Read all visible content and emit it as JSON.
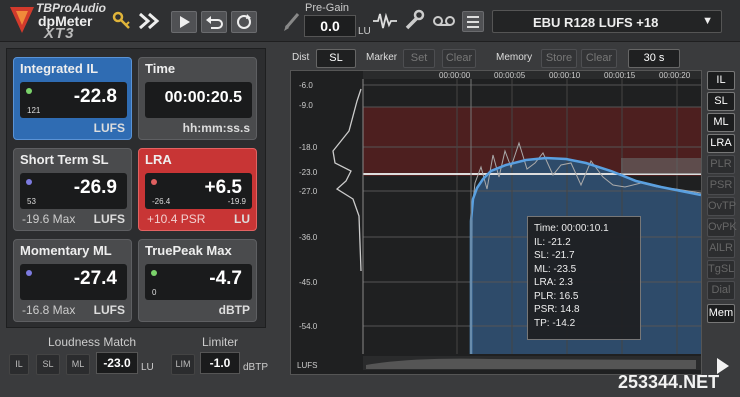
{
  "app": {
    "brand": "TBProAudio",
    "product": "dpMeter",
    "edition": "XT3"
  },
  "toolbar": {
    "pregain_label": "Pre-Gain",
    "pregain_value": "0.0",
    "pregain_unit": "LU",
    "preset": "EBU R128 LUFS +18"
  },
  "meters": [
    {
      "title": "Integrated IL",
      "value": "-22.8",
      "small": "121",
      "foot_left": "",
      "foot_right": "LUFS",
      "color": "#2f6cb3",
      "dot": "#7bd36b"
    },
    {
      "title": "Time",
      "value": "00:00:20.5",
      "foot_left": "",
      "foot_right": "hh:mm:ss.s"
    },
    {
      "title": "Short Term SL",
      "value": "-26.9",
      "small": "53",
      "foot_left": "-19.6 Max",
      "foot_right": "LUFS",
      "dot": "#7d7be0"
    },
    {
      "title": "LRA",
      "value": "+6.5",
      "small": "-26.4",
      "small2": "-19.9",
      "foot_left": "+10.4 PSR",
      "foot_right": "LU",
      "color": "#c83535",
      "dot": "#7bd36b"
    },
    {
      "title": "Momentary ML",
      "value": "-27.4",
      "foot_left": "-16.8 Max",
      "foot_right": "LUFS",
      "dot": "#7d7be0"
    },
    {
      "title": "TruePeak Max",
      "value": "-4.7",
      "small": "0",
      "foot_left": "",
      "foot_right": "dBTP",
      "dot": "#7bd36b"
    }
  ],
  "loudness_match": {
    "label": "Loudness Match",
    "buttons": [
      "IL",
      "SL",
      "ML"
    ],
    "value": "-23.0",
    "unit": "LU"
  },
  "limiter": {
    "label": "Limiter",
    "button": "LIM",
    "value": "-1.0",
    "unit": "dBTP"
  },
  "graph_controls": {
    "dist_label": "Dist",
    "dist_value": "SL",
    "marker_label": "Marker",
    "marker_set": "Set",
    "marker_clear": "Clear",
    "memory_label": "Memory",
    "memory_store": "Store",
    "memory_clear": "Clear",
    "window": "30 s"
  },
  "graph": {
    "y_ticks": [
      "-6.0",
      "-9.0",
      "-18.0",
      "-23.0",
      "-27.0",
      "-36.0",
      "-45.0",
      "-54.0"
    ],
    "x_ticks": [
      "00:00:00",
      "00:00:05",
      "00:00:10",
      "00:00:15",
      "00:00:20"
    ],
    "unit": "LUFS",
    "tooltip": [
      "Time: 00:00:10.1",
      "IL: -21.2",
      "SL: -21.7",
      "ML: -23.5",
      "LRA: 2.3",
      "PLR: 16.5",
      "PSR: 14.8",
      "TP: -14.2"
    ]
  },
  "side_buttons": [
    {
      "label": "IL",
      "on": true
    },
    {
      "label": "SL",
      "on": true
    },
    {
      "label": "ML",
      "on": true
    },
    {
      "label": "LRA",
      "on": true
    },
    {
      "label": "PLR",
      "on": false
    },
    {
      "label": "PSR",
      "on": false
    },
    {
      "label": "OvTP",
      "on": false
    },
    {
      "label": "OvPK",
      "on": false
    },
    {
      "label": "AlLR",
      "on": false
    },
    {
      "label": "TgSL",
      "on": false
    },
    {
      "label": "Dial",
      "on": false
    },
    {
      "label": "Mem",
      "on": true
    }
  ],
  "watermark": "253344.NET"
}
